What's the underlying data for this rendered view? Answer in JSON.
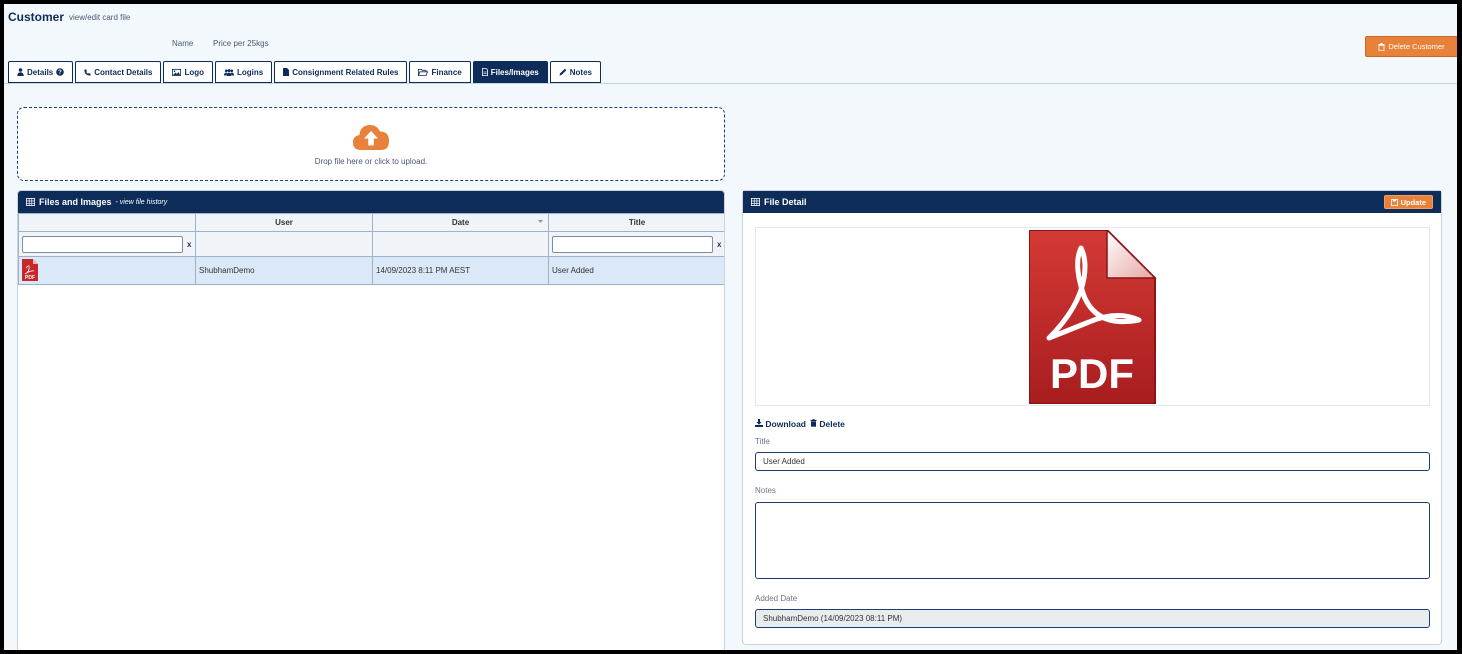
{
  "header": {
    "title": "Customer",
    "subtitle": "view/edit card file",
    "name_label": "Name",
    "name_value": "Price per 25kgs",
    "delete_label": "Delete Customer"
  },
  "tabs": [
    {
      "label": "Details",
      "icon": "user-icon",
      "active": false
    },
    {
      "label": "Contact Details",
      "icon": "phone-icon",
      "active": false
    },
    {
      "label": "Logo",
      "icon": "image-icon",
      "active": false
    },
    {
      "label": "Logins",
      "icon": "users-icon",
      "active": false
    },
    {
      "label": "Consignment Related Rules",
      "icon": "file-icon",
      "active": false
    },
    {
      "label": "Finance",
      "icon": "folder-icon",
      "active": false
    },
    {
      "label": "Files/Images",
      "icon": "file-icon",
      "active": true
    },
    {
      "label": "Notes",
      "icon": "pencil-icon",
      "active": false
    }
  ],
  "dropzone": {
    "text": "Drop file here or click to upload.",
    "icon": "cloud-upload-icon",
    "icon_color": "#e8823a"
  },
  "files_panel": {
    "title": "Files and Images",
    "subtitle": "- view file history",
    "columns": [
      "",
      "User",
      "Date",
      "Title"
    ],
    "filter_clear": "x",
    "rows": [
      {
        "icon": "pdf-icon",
        "icon_text": "PDF",
        "user": "ShubhamDemo",
        "date": "14/09/2023 8:11 PM AEST",
        "title": "User Added"
      }
    ]
  },
  "detail_panel": {
    "title": "File Detail",
    "update_label": "Update",
    "preview_text": "PDF",
    "download_label": "Download",
    "delete_label": "Delete",
    "title_label": "Title",
    "title_value": "User Added",
    "notes_label": "Notes",
    "notes_value": "",
    "added_label": "Added Date",
    "added_value": "ShubhamDemo (14/09/2023 08:11 PM)"
  },
  "colors": {
    "primary": "#0d2c5a",
    "accent": "#e8823a",
    "pdf_red": "#c8272a",
    "row_selected": "#dbe8f8"
  }
}
